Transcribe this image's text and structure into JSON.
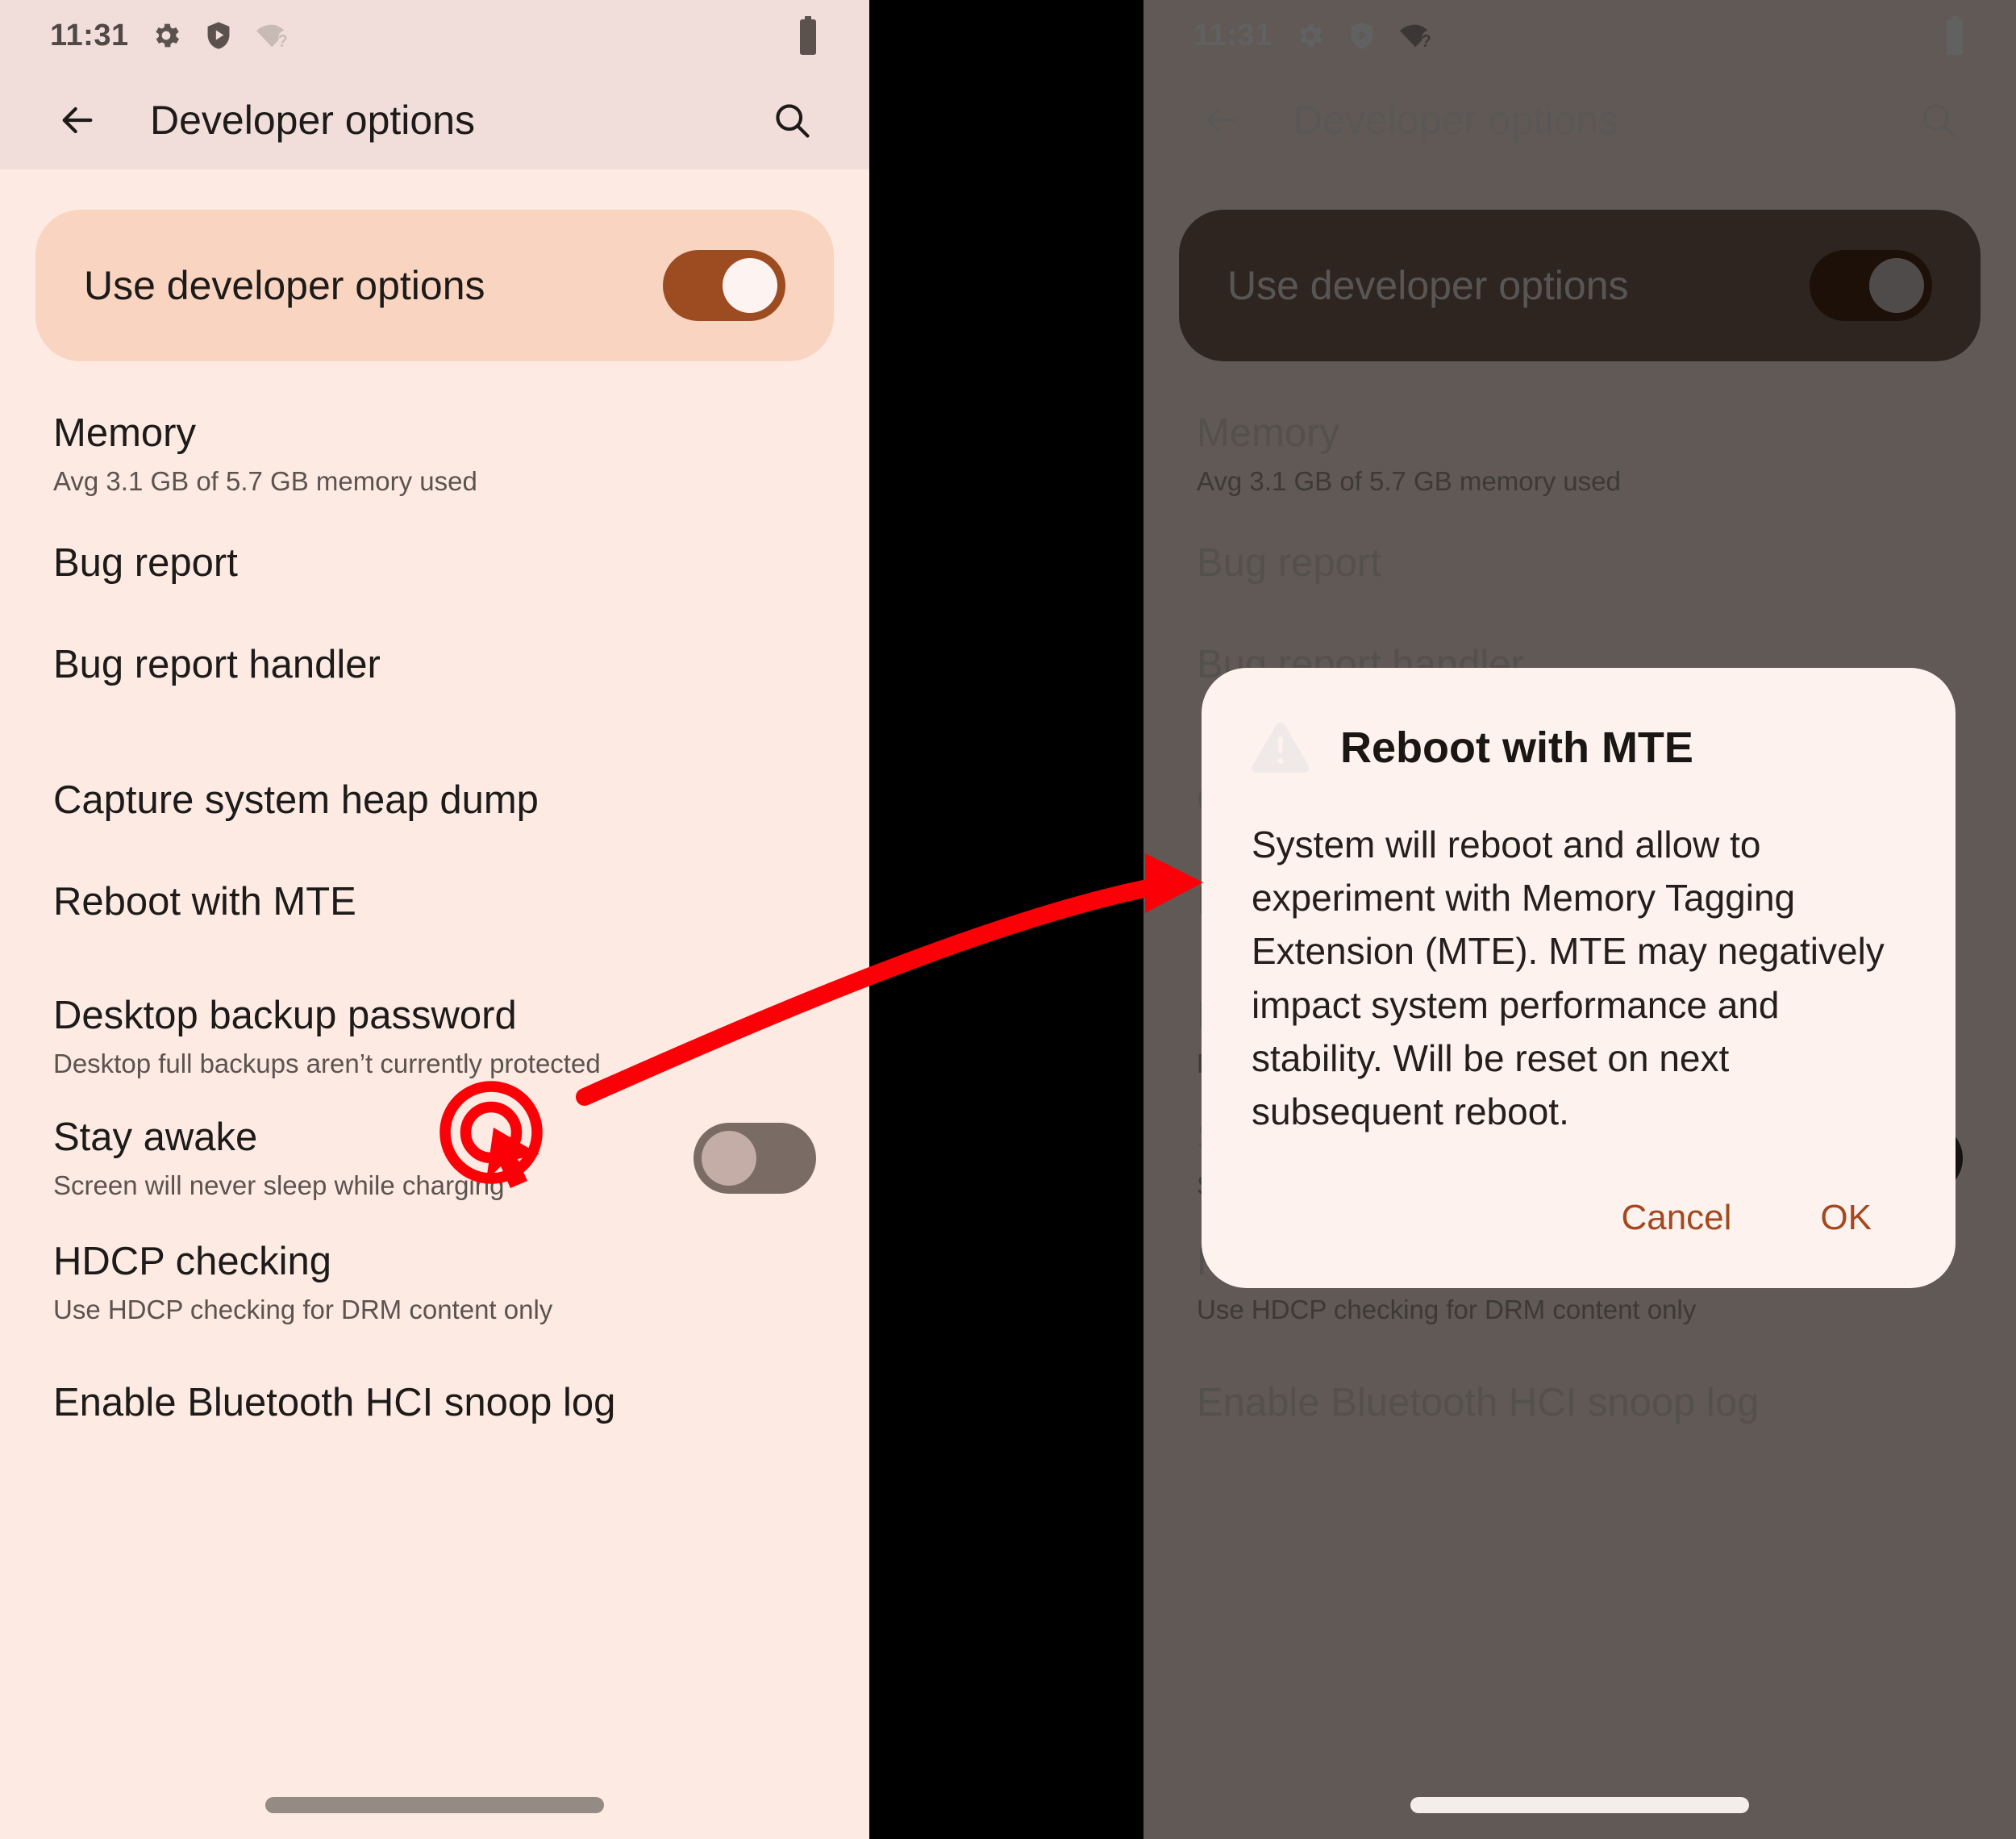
{
  "status_bar": {
    "time": "11:31",
    "icons": [
      "gear-icon",
      "shield-play-icon",
      "wifi-question-icon"
    ],
    "battery": "battery-charging-icon"
  },
  "app_bar": {
    "back_label": "back-arrow",
    "title": "Developer options",
    "search_label": "search"
  },
  "hero": {
    "label": "Use developer options",
    "toggle_state": "on"
  },
  "settings": [
    {
      "title": "Memory",
      "subtitle": "Avg 3.1 GB of 5.7 GB memory used",
      "toggle": null
    },
    {
      "title": "Bug report",
      "subtitle": "",
      "toggle": null
    },
    {
      "title": "Bug report handler",
      "subtitle": "",
      "toggle": null
    },
    {
      "title": "Capture system heap dump",
      "subtitle": "",
      "toggle": null
    },
    {
      "title": "Reboot with MTE",
      "subtitle": "",
      "toggle": null
    },
    {
      "title": "Desktop backup password",
      "subtitle": "Desktop full backups aren’t currently protected",
      "toggle": null
    },
    {
      "title": "Stay awake",
      "subtitle": "Screen will never sleep while charging",
      "toggle": "off"
    },
    {
      "title": "HDCP checking",
      "subtitle": "Use HDCP checking for DRM content only",
      "toggle": null
    },
    {
      "title": "Enable Bluetooth HCI snoop log",
      "subtitle": "",
      "toggle": null
    }
  ],
  "dialog": {
    "icon": "warning-triangle-icon",
    "title": "Reboot with MTE",
    "body": "System will reboot and allow to experiment with Memory Tagging Extension (MTE). MTE may negatively impact system performance and stability. Will be reset on next subsequent reboot.",
    "cancel_label": "Cancel",
    "ok_label": "OK"
  },
  "annotation": {
    "click_target": "Reboot with MTE",
    "arrow_color": "#FB0007",
    "click_indicator": "click-target-cursor-icon"
  },
  "colors": {
    "surface": "#FCEAE3",
    "surface_bar": "#F1DEDA",
    "hero_card": "#F9D4C0",
    "accent_brown": "#9D4B21",
    "dialog_surface": "#FDF2EE",
    "dialog_action": "#A4491F",
    "scrim": "rgba(0,0,0,0.62)",
    "divider_black": "#000000"
  }
}
